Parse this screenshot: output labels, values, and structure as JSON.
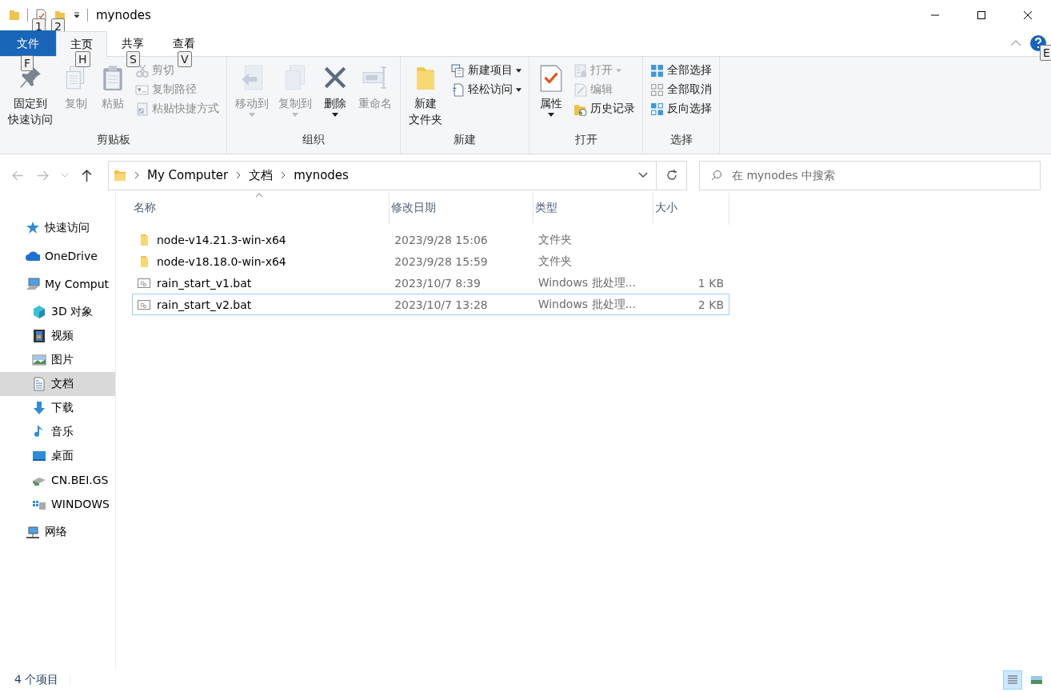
{
  "title_bar": {
    "title": "mynodes",
    "quick_access_keytips": [
      "1",
      "2"
    ]
  },
  "ribbon_tabs": [
    {
      "label": "文件",
      "kind": "file",
      "keytip": "F",
      "selected": false
    },
    {
      "label": "主页",
      "kind": "normal",
      "keytip": "H",
      "selected": true
    },
    {
      "label": "共享",
      "kind": "normal",
      "keytip": "S",
      "selected": false
    },
    {
      "label": "查看",
      "kind": "normal",
      "keytip": "V",
      "selected": false
    }
  ],
  "help_keytip": "E",
  "ribbon_groups": [
    {
      "label": "剪贴板",
      "commands": [
        {
          "kind": "large",
          "lines": [
            "固定到",
            "快速访问"
          ],
          "disabled": false,
          "has_menu": false
        },
        {
          "kind": "large",
          "lines": [
            "复制"
          ],
          "disabled": true,
          "has_menu": false
        },
        {
          "kind": "large",
          "lines": [
            "粘贴"
          ],
          "disabled": true,
          "has_menu": false
        },
        {
          "kind": "small",
          "lines": [
            "剪切"
          ],
          "disabled": true,
          "has_menu": false
        },
        {
          "kind": "small",
          "lines": [
            "复制路径"
          ],
          "disabled": true,
          "has_menu": false
        },
        {
          "kind": "small",
          "lines": [
            "粘贴快捷方式"
          ],
          "disabled": true,
          "has_menu": false
        }
      ]
    },
    {
      "label": "组织",
      "commands": [
        {
          "kind": "large",
          "lines": [
            "移动到"
          ],
          "disabled": true,
          "has_menu": true
        },
        {
          "kind": "large",
          "lines": [
            "复制到"
          ],
          "disabled": true,
          "has_menu": true
        },
        {
          "kind": "large",
          "lines": [
            "删除"
          ],
          "disabled": false,
          "has_menu": true
        },
        {
          "kind": "large",
          "lines": [
            "重命名"
          ],
          "disabled": true,
          "has_menu": false
        }
      ]
    },
    {
      "label": "新建",
      "commands": [
        {
          "kind": "large",
          "lines": [
            "新建",
            "文件夹"
          ],
          "disabled": false,
          "has_menu": false
        },
        {
          "kind": "small",
          "lines": [
            "新建项目"
          ],
          "disabled": false,
          "has_menu": true
        },
        {
          "kind": "small",
          "lines": [
            "轻松访问"
          ],
          "disabled": false,
          "has_menu": true
        }
      ]
    },
    {
      "label": "打开",
      "commands": [
        {
          "kind": "large",
          "lines": [
            "属性"
          ],
          "disabled": false,
          "has_menu": true
        },
        {
          "kind": "small",
          "lines": [
            "打开"
          ],
          "disabled": true,
          "has_menu": true
        },
        {
          "kind": "small",
          "lines": [
            "编辑"
          ],
          "disabled": true,
          "has_menu": false
        },
        {
          "kind": "small",
          "lines": [
            "历史记录"
          ],
          "disabled": false,
          "has_menu": false
        }
      ]
    },
    {
      "label": "选择",
      "commands": [
        {
          "kind": "small",
          "lines": [
            "全部选择"
          ],
          "disabled": false,
          "has_menu": false
        },
        {
          "kind": "small",
          "lines": [
            "全部取消"
          ],
          "disabled": false,
          "has_menu": false
        },
        {
          "kind": "small",
          "lines": [
            "反向选择"
          ],
          "disabled": false,
          "has_menu": false
        }
      ]
    }
  ],
  "address_bar": {
    "crumbs": [
      "My Computer",
      "文档",
      "mynodes"
    ]
  },
  "search": {
    "placeholder": "在 mynodes 中搜索"
  },
  "nav_pane": {
    "items": [
      {
        "label": "快速访问",
        "selected": false
      },
      {
        "label": "OneDrive",
        "selected": false
      },
      {
        "label": "My Comput",
        "selected": false,
        "children": [
          {
            "label": "3D 对象",
            "selected": false
          },
          {
            "label": "视频",
            "selected": false
          },
          {
            "label": "图片",
            "selected": false
          },
          {
            "label": "文档",
            "selected": true
          },
          {
            "label": "下载",
            "selected": false
          },
          {
            "label": "音乐",
            "selected": false
          },
          {
            "label": "桌面",
            "selected": false
          },
          {
            "label": "CN.BEI.GS",
            "selected": false
          },
          {
            "label": "WINDOWS",
            "selected": false
          }
        ]
      },
      {
        "label": "网络",
        "selected": false
      }
    ]
  },
  "file_list": {
    "columns": [
      {
        "label": "名称",
        "sorted": true
      },
      {
        "label": "修改日期",
        "sorted": false
      },
      {
        "label": "类型",
        "sorted": false
      },
      {
        "label": "大小",
        "sorted": false
      }
    ],
    "rows": [
      {
        "kind": "folder",
        "name": "node-v14.21.3-win-x64",
        "modified": "2023/9/28 15:06",
        "type": "文件夹",
        "focused": false
      },
      {
        "kind": "folder",
        "name": "node-v18.18.0-win-x64",
        "modified": "2023/9/28 15:59",
        "type": "文件夹",
        "focused": false
      },
      {
        "kind": "batch",
        "name": "rain_start_v1.bat",
        "modified": "2023/10/7 8:39",
        "type": "Windows 批处理...",
        "size": "1 KB",
        "focused": false
      },
      {
        "kind": "batch",
        "name": "rain_start_v2.bat",
        "modified": "2023/10/7 13:28",
        "type": "Windows 批处理...",
        "size": "2 KB",
        "focused": true
      }
    ]
  },
  "status_bar": {
    "item_count": "4 个项目",
    "views": [
      {
        "kind": "details",
        "selected": true
      },
      {
        "kind": "large_icons",
        "selected": false
      }
    ]
  }
}
